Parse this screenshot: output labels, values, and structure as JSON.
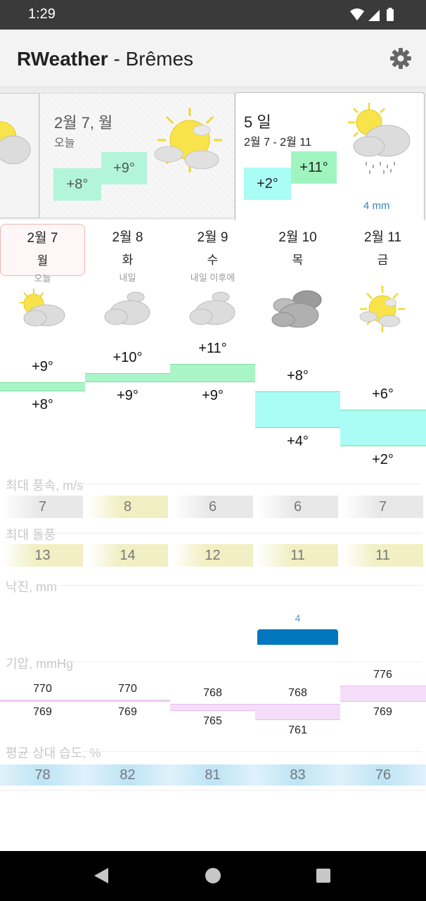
{
  "status": {
    "time": "1:29"
  },
  "app": {
    "name": "RWeather",
    "sep": " - ",
    "city": "Brêmes"
  },
  "today_card": {
    "date": "2월 7, 월",
    "sub": "오늘",
    "low": "+8°",
    "high": "+9°"
  },
  "five_card": {
    "title": "5 일",
    "range": "2월 7 - 2월 11",
    "low": "+2°",
    "high": "+11°",
    "precip": "4 mm"
  },
  "days": [
    {
      "date": "2월 7",
      "weekday": "월",
      "note": "오늘",
      "icon": "partly-sunny",
      "high": "+9°",
      "low": "+8°",
      "high_v": 9,
      "low_v": 8,
      "wind": "7",
      "gust": "13",
      "precip": "",
      "precip_v": 0,
      "p_high": "770",
      "p_low": "769",
      "p_high_v": 770,
      "p_low_v": 769,
      "humidity": "78"
    },
    {
      "date": "2월 8",
      "weekday": "화",
      "note": "내일",
      "icon": "cloudy",
      "high": "+10°",
      "low": "+9°",
      "high_v": 10,
      "low_v": 9,
      "wind": "8",
      "gust": "14",
      "precip": "",
      "precip_v": 0,
      "p_high": "770",
      "p_low": "769",
      "p_high_v": 770,
      "p_low_v": 769,
      "humidity": "82"
    },
    {
      "date": "2월 9",
      "weekday": "수",
      "note": "내일 이후에",
      "icon": "cloudy",
      "high": "+11°",
      "low": "+9°",
      "high_v": 11,
      "low_v": 9,
      "wind": "6",
      "gust": "12",
      "precip": "",
      "precip_v": 0,
      "p_high": "768",
      "p_low": "765",
      "p_high_v": 768,
      "p_low_v": 765,
      "humidity": "81"
    },
    {
      "date": "2월 10",
      "weekday": "목",
      "note": "",
      "icon": "dark-cloudy",
      "high": "+8°",
      "low": "+4°",
      "high_v": 8,
      "low_v": 4,
      "wind": "6",
      "gust": "11",
      "precip": "4",
      "precip_v": 4,
      "p_high": "768",
      "p_low": "761",
      "p_high_v": 768,
      "p_low_v": 761,
      "humidity": "83"
    },
    {
      "date": "2월 11",
      "weekday": "금",
      "note": "",
      "icon": "sunny-clouds",
      "high": "+6°",
      "low": "+2°",
      "high_v": 6,
      "low_v": 2,
      "wind": "7",
      "gust": "11",
      "precip": "",
      "precip_v": 0,
      "p_high": "776",
      "p_low": "769",
      "p_high_v": 776,
      "p_low_v": 769,
      "humidity": "76"
    }
  ],
  "sections": {
    "wind": "최대 풍속, m/s",
    "gust": "최대 돌풍",
    "precip": "낙진, mm",
    "pressure": "기압, mmHg",
    "humidity": "평균 상대 습도, %"
  },
  "colors": {
    "sun": "#f8e44a",
    "cloud": "#d9d9d9",
    "cloud_dark": "#9b9b9b",
    "temp_green": "#aaf5c8",
    "temp_cyan": "#a9fdf5",
    "precip_blue": "#0277bd",
    "pressure": "#f3d7f8",
    "humidity": "#bde4f6",
    "gust": "#f2efc4"
  }
}
